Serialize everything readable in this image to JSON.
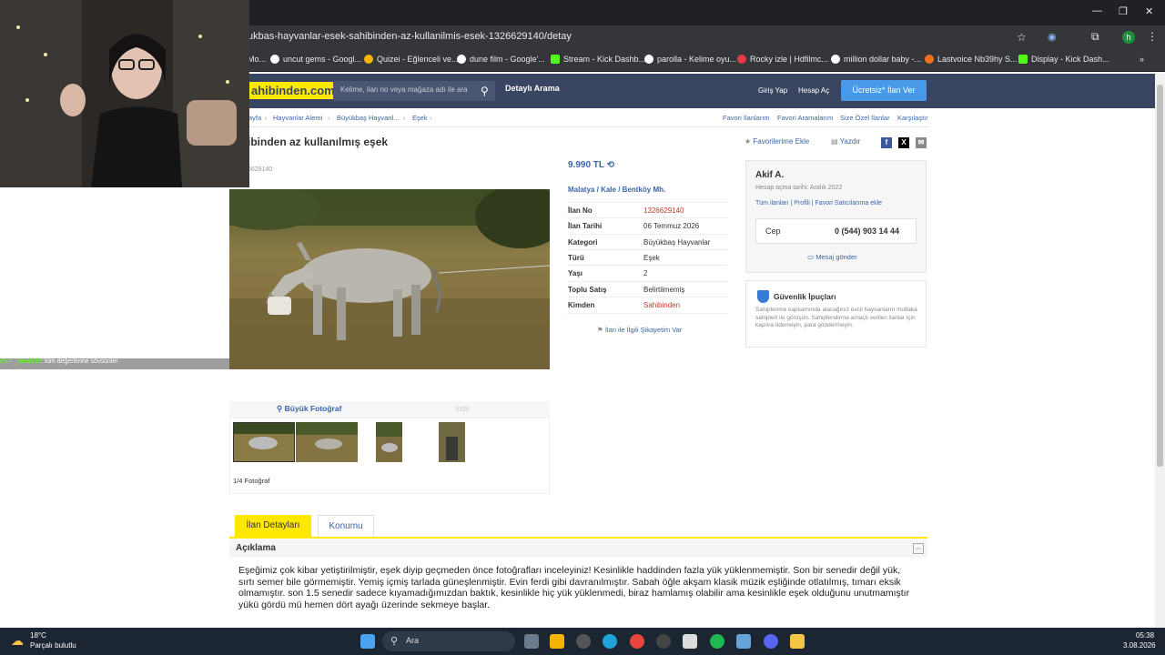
{
  "browser": {
    "url": "ukbas-hayvanlar-esek-sahibinden-az-kullanilmis-esek-1326629140/detay",
    "bookmarks": [
      {
        "label": "Mo..."
      },
      {
        "label": "uncut gems - Googl..."
      },
      {
        "label": "Quizei - Eğlenceli ve..."
      },
      {
        "label": "dune film - Google'..."
      },
      {
        "label": "Stream - Kick Dashb..."
      },
      {
        "label": "parolla - Kelime oyu..."
      },
      {
        "label": "Rocky izle | Hdfilmc..."
      },
      {
        "label": "million dollar baby -..."
      },
      {
        "label": "Lastvoice Nb39hy S..."
      },
      {
        "label": "Display - Kick Dash..."
      }
    ],
    "more_bookmarks": "»"
  },
  "site": {
    "logo": "ahibinden.com",
    "search_placeholder": "Kelime, ilan no veya mağaza adı ile ara",
    "detailed_search": "Detaylı Arama",
    "login": "Giriş Yap",
    "register": "Hesap Aç",
    "post_ad": "Ücretsiz* İlan Ver"
  },
  "breadcrumb": [
    "ayfa",
    "Hayvanlar Alemi",
    "Büyükbaş Hayvanl...",
    "Eşek"
  ],
  "top_links": [
    "Favori İlanlarım",
    "Favori Aramalarım",
    "Size Özel İlanlar",
    "Karşılaştır"
  ],
  "listing": {
    "title": "ibinden az kullanılmış eşek",
    "id_partial": "6629140",
    "add_favorite": "Favorilerime Ekle",
    "print": "Yazdır",
    "price": "9.990 TL",
    "location": [
      "Malatya",
      "Kale",
      "Bentköy Mh."
    ],
    "location_sep": "/",
    "info": [
      {
        "key": "İlan No",
        "value": "1326629140",
        "color": "#c0392b"
      },
      {
        "key": "İlan Tarihi",
        "value": "06 Temmuz 2026",
        "color": "#333333"
      },
      {
        "key": "Kategori",
        "value": "Büyükbaş Hayvanlar",
        "color": "#333333"
      },
      {
        "key": "Türü",
        "value": "Eşek",
        "color": "#333333"
      },
      {
        "key": "Yaşı",
        "value": "2",
        "color": "#333333"
      },
      {
        "key": "Toplu Satış",
        "value": "Belirtilmemiş",
        "color": "#333333"
      },
      {
        "key": "Kimden",
        "value": "Sahibinden",
        "color": "#c0392b"
      }
    ],
    "complaint": "İlan ile İlgili Şikayetim Var",
    "photo_big": "Büyük Fotoğraf",
    "photo_download": "İndir",
    "photo_count": "1/4 Fotoğraf"
  },
  "seller": {
    "name": "Akif A.",
    "since": "Hesap açma tarihi: Aralık 2022",
    "links": [
      "Tüm ilanları",
      "Profili",
      "Favori Satıcılarıma ekle"
    ],
    "phone_label": "Cep",
    "phone": "0 (544) 903 14 44",
    "message": "Mesaj gönder"
  },
  "tips": {
    "title": "Güvenlik İpuçları",
    "text": "Sahiplenme kapsamında alacağınız evcil hayvanların mutlaka sahipleri ile görüşün. Sahiplendirme amaçlı verilen ilanlar için kapora ödemeyin, para göndermeyin."
  },
  "tabs": [
    "İlan Detayları",
    "Konumu"
  ],
  "description": {
    "header": "Açıklama",
    "text": "Eşeğimiz çok kibar yetiştirilmiştir, eşek diyip geçmeden önce fotoğrafları inceleyiniz! Kesinlikle haddinden fazla yük yüklenmemiştir. Son bir senedir değil yük, sırtı semer bile görmemiştir. Yemiş içmiş tarlada güneşlenmiştir. Evin ferdi gibi davranılmıştır. Sabah öğle akşam klasik müzik eşliğinde otlatılmış, tımarı eksik olmamıştır. son 1.5 senedir sadece kıyamadığımızdan baktık, kesinlikle hiç yük yüklenmedi, biraz hamlamış olabilir ama kesinlikle eşek olduğunu unutmamıştır yükü gördü mü hemen dört ayağı üzerinde sekmeye başlar."
  },
  "overlay": {
    "chat_user": "ictim_sarabi00",
    "chat_message": "tüm değerlerine sövsünler"
  },
  "taskbar": {
    "temp": "18°C",
    "weather": "Parçalı bulutlu",
    "search": "Ara",
    "time": "05:38",
    "date": "3.08.2026"
  }
}
